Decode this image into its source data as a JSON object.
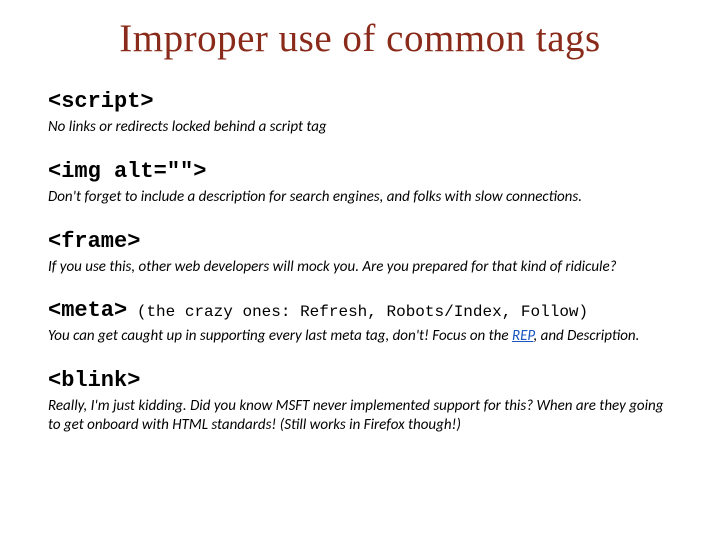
{
  "title": "Improper use of common tags",
  "sections": {
    "script": {
      "code": "<script>",
      "desc": "No links or redirects locked behind a script tag"
    },
    "img": {
      "code": "<img alt=\"\">",
      "desc": "Don't forget to include a description for search engines, and folks with slow connections."
    },
    "frame": {
      "code": "<frame>",
      "desc": "If you use this, other web developers will mock you. Are you prepared for that kind of ridicule?"
    },
    "meta": {
      "code": "<meta>",
      "inline": "(the crazy ones: Refresh, Robots/Index, Follow)",
      "desc_pre": "You can get caught up in supporting every last meta tag, don't! Focus on the ",
      "link": "REP",
      "desc_post": ", and Description."
    },
    "blink": {
      "code": "<blink>",
      "desc": "Really, I'm just kidding. Did you know MSFT never implemented support for this? When are they going to get onboard with HTML standards! (Still works in Firefox though!)"
    }
  }
}
